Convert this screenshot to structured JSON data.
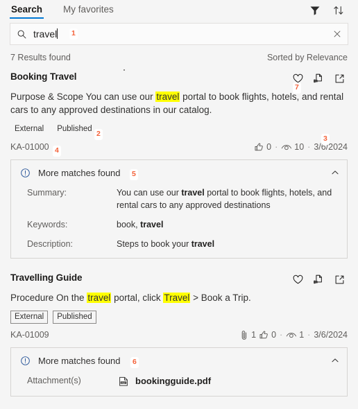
{
  "header": {
    "tabs": [
      {
        "label": "Search",
        "active": true
      },
      {
        "label": "My favorites",
        "active": false
      }
    ],
    "filter_icon": "filter-icon",
    "sort_icon": "sort-icon"
  },
  "search": {
    "value": "travel",
    "placeholder": "Search",
    "search_icon": "search-icon",
    "clear_icon": "clear-icon",
    "marker": "1"
  },
  "summary": {
    "count_label": "7 Results found",
    "sorted_label": "Sorted by Relevance"
  },
  "results": [
    {
      "title": "Booking Travel",
      "snippet_parts": [
        {
          "text": "Purpose & Scope You can use our ",
          "highlight": false
        },
        {
          "text": "travel",
          "highlight": true
        },
        {
          "text": " portal to book flights, hotels, and rent",
          "highlight": false
        },
        {
          "text": "al cars to any approved destinations in our catalog.",
          "highlight": false
        }
      ],
      "tags": [
        {
          "label": "External",
          "bordered": false
        },
        {
          "label": "Published",
          "bordered": false
        }
      ],
      "tags_marker": "2",
      "kb_id": "KA-01000",
      "kb_id_marker": "4",
      "stats_marker": "3",
      "actions_marker": "7",
      "stats": {
        "attachments": null,
        "likes": "0",
        "views": "10",
        "date": "3/6/2024"
      },
      "actions": [
        {
          "icon": "favorite-heart-icon"
        },
        {
          "icon": "copy-link-icon"
        },
        {
          "icon": "open-in-new-window-icon"
        }
      ],
      "matches": {
        "title": "More matches found",
        "marker": "5",
        "info_icon": "info-icon",
        "chevron_icon": "chevron-up-icon",
        "rows": [
          {
            "key": "Summary:",
            "value_parts": [
              {
                "text": "You can use our ",
                "bold": false
              },
              {
                "text": "travel",
                "bold": true
              },
              {
                "text": " portal to book flights, hotels, and rental cars to any approved destinations",
                "bold": false
              }
            ]
          },
          {
            "key": "Keywords:",
            "value_parts": [
              {
                "text": "book, ",
                "bold": false
              },
              {
                "text": "travel",
                "bold": true
              }
            ]
          },
          {
            "key": "Description:",
            "value_parts": [
              {
                "text": "Steps to book your ",
                "bold": false
              },
              {
                "text": "travel",
                "bold": true
              }
            ]
          }
        ]
      }
    },
    {
      "title": "Travelling Guide",
      "snippet_parts": [
        {
          "text": "Procedure On the ",
          "highlight": false
        },
        {
          "text": "travel",
          "highlight": true
        },
        {
          "text": " portal, click ",
          "highlight": false
        },
        {
          "text": "Travel",
          "highlight": true
        },
        {
          "text": " > Book a Trip.",
          "highlight": false
        }
      ],
      "tags": [
        {
          "label": "External",
          "bordered": true
        },
        {
          "label": "Published",
          "bordered": true
        }
      ],
      "tags_marker": null,
      "kb_id": "KA-01009",
      "kb_id_marker": null,
      "stats_marker": null,
      "actions_marker": null,
      "stats": {
        "attachments": "1",
        "likes": "0",
        "views": "1",
        "date": "3/6/2024"
      },
      "actions": [
        {
          "icon": "favorite-heart-icon"
        },
        {
          "icon": "copy-link-icon"
        },
        {
          "icon": "open-in-new-window-icon"
        }
      ],
      "matches": {
        "title": "More matches found",
        "marker": "6",
        "info_icon": "info-icon",
        "chevron_icon": "chevron-up-icon",
        "rows": [
          {
            "key": "Attachment(s)",
            "attachment": {
              "filename": "bookingguide.pdf",
              "icon": "pdf-file-icon"
            }
          }
        ]
      }
    }
  ],
  "colors": {
    "accent": "#0078d4",
    "marker": "#f4623a",
    "highlight": "#ffff00",
    "background": "#f5f5f5"
  }
}
